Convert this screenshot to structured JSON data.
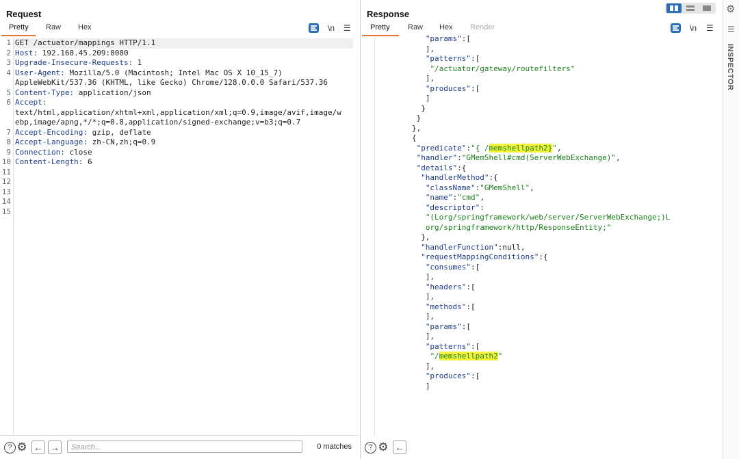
{
  "request": {
    "title": "Request",
    "tabs": [
      "Pretty",
      "Raw",
      "Hex"
    ],
    "newline_label": "\\n",
    "lines": [
      {
        "n": "1",
        "text": "GET /actuator/mappings HTTP/1.1"
      },
      {
        "n": "2",
        "key": "Host:",
        "text": " 192.168.45.209:8080"
      },
      {
        "n": "3",
        "key": "Upgrade-Insecure-Requests:",
        "text": " 1"
      },
      {
        "n": "4",
        "key": "User-Agent:",
        "text": " Mozilla/5.0 (Macintosh; Intel Mac OS X 10_15_7)"
      },
      {
        "n": "",
        "text": "AppleWebKit/537.36 (KHTML, like Gecko) Chrome/128.0.0.0 Safari/537.36"
      },
      {
        "n": "5",
        "key": "Content-Type:",
        "text": " application/json"
      },
      {
        "n": "6",
        "key": "Accept:",
        "text": ""
      },
      {
        "n": "",
        "text": "text/html,application/xhtml+xml,application/xml;q=0.9,image/avif,image/w"
      },
      {
        "n": "",
        "text": "ebp,image/apng,*/*;q=0.8,application/signed-exchange;v=b3;q=0.7"
      },
      {
        "n": "7",
        "key": "Accept-Encoding:",
        "text": " gzip, deflate"
      },
      {
        "n": "8",
        "key": "Accept-Language:",
        "text": " zh-CN,zh;q=0.9"
      },
      {
        "n": "9",
        "key": "Connection:",
        "text": " close"
      },
      {
        "n": "10",
        "key": "Content-Length:",
        "text": " 6"
      },
      {
        "n": "11",
        "text": ""
      },
      {
        "n": "12",
        "text": ""
      },
      {
        "n": "13",
        "text": ""
      },
      {
        "n": "14",
        "text": ""
      },
      {
        "n": "15",
        "text": ""
      }
    ]
  },
  "response": {
    "title": "Response",
    "tabs": [
      "Pretty",
      "Raw",
      "Hex",
      "Render"
    ],
    "newline_label": "\\n",
    "lines": [
      {
        "i": 11,
        "parts": [
          [
            "k",
            "\"params\""
          ],
          [
            "p",
            ":["
          ]
        ]
      },
      {
        "i": 11,
        "parts": [
          [
            "p",
            "],"
          ]
        ]
      },
      {
        "i": 11,
        "parts": [
          [
            "k",
            "\"patterns\""
          ],
          [
            "p",
            ":["
          ]
        ]
      },
      {
        "i": 12,
        "parts": [
          [
            "s",
            "\"/actuator/gateway/routefilters\""
          ]
        ]
      },
      {
        "i": 11,
        "parts": [
          [
            "p",
            "],"
          ]
        ]
      },
      {
        "i": 11,
        "parts": [
          [
            "k",
            "\"produces\""
          ],
          [
            "p",
            ":["
          ]
        ]
      },
      {
        "i": 11,
        "parts": [
          [
            "p",
            "]"
          ]
        ]
      },
      {
        "i": 10,
        "parts": [
          [
            "p",
            "}"
          ]
        ]
      },
      {
        "i": 9,
        "parts": [
          [
            "p",
            "}"
          ]
        ]
      },
      {
        "i": 8,
        "parts": [
          [
            "p",
            "},"
          ]
        ]
      },
      {
        "i": 8,
        "parts": [
          [
            "p",
            "{"
          ]
        ]
      },
      {
        "i": 9,
        "parts": [
          [
            "k",
            "\"predicate\""
          ],
          [
            "p",
            ":"
          ],
          [
            "s",
            "\"{ /"
          ],
          [
            "m",
            "memshellpath2}"
          ],
          [
            "s",
            "\""
          ],
          [
            "p",
            ","
          ]
        ]
      },
      {
        "i": 9,
        "parts": [
          [
            "k",
            "\"handler\""
          ],
          [
            "p",
            ":"
          ],
          [
            "s",
            "\"GMemShell#cmd(ServerWebExchange)\""
          ],
          [
            "p",
            ","
          ]
        ]
      },
      {
        "i": 9,
        "parts": [
          [
            "k",
            "\"details\""
          ],
          [
            "p",
            ":{"
          ]
        ]
      },
      {
        "i": 10,
        "parts": [
          [
            "k",
            "\"handlerMethod\""
          ],
          [
            "p",
            ":{"
          ]
        ]
      },
      {
        "i": 11,
        "parts": [
          [
            "k",
            "\"className\""
          ],
          [
            "p",
            ":"
          ],
          [
            "s",
            "\"GMemShell\""
          ],
          [
            "p",
            ","
          ]
        ]
      },
      {
        "i": 11,
        "parts": [
          [
            "k",
            "\"name\""
          ],
          [
            "p",
            ":"
          ],
          [
            "s",
            "\"cmd\""
          ],
          [
            "p",
            ","
          ]
        ]
      },
      {
        "i": 11,
        "parts": [
          [
            "k",
            "\"descriptor\""
          ],
          [
            "p",
            ":"
          ]
        ]
      },
      {
        "i": 11,
        "parts": [
          [
            "s",
            "\"(Lorg/springframework/web/server/ServerWebExchange;)L"
          ]
        ]
      },
      {
        "i": 11,
        "parts": [
          [
            "s",
            "org/springframework/http/ResponseEntity;\""
          ]
        ]
      },
      {
        "i": 10,
        "parts": [
          [
            "p",
            "},"
          ]
        ]
      },
      {
        "i": 10,
        "parts": [
          [
            "k",
            "\"handlerFunction\""
          ],
          [
            "p",
            ":null,"
          ]
        ]
      },
      {
        "i": 10,
        "parts": [
          [
            "k",
            "\"requestMappingConditions\""
          ],
          [
            "p",
            ":{"
          ]
        ]
      },
      {
        "i": 11,
        "parts": [
          [
            "k",
            "\"consumes\""
          ],
          [
            "p",
            ":["
          ]
        ]
      },
      {
        "i": 11,
        "parts": [
          [
            "p",
            "],"
          ]
        ]
      },
      {
        "i": 11,
        "parts": [
          [
            "k",
            "\"headers\""
          ],
          [
            "p",
            ":["
          ]
        ]
      },
      {
        "i": 11,
        "parts": [
          [
            "p",
            "],"
          ]
        ]
      },
      {
        "i": 11,
        "parts": [
          [
            "k",
            "\"methods\""
          ],
          [
            "p",
            ":["
          ]
        ]
      },
      {
        "i": 11,
        "parts": [
          [
            "p",
            "],"
          ]
        ]
      },
      {
        "i": 11,
        "parts": [
          [
            "k",
            "\"params\""
          ],
          [
            "p",
            ":["
          ]
        ]
      },
      {
        "i": 11,
        "parts": [
          [
            "p",
            "],"
          ]
        ]
      },
      {
        "i": 11,
        "parts": [
          [
            "k",
            "\"patterns\""
          ],
          [
            "p",
            ":["
          ]
        ]
      },
      {
        "i": 12,
        "parts": [
          [
            "s",
            "\"/"
          ],
          [
            "m",
            "memshellpath2"
          ],
          [
            "s",
            "\""
          ]
        ]
      },
      {
        "i": 11,
        "parts": [
          [
            "p",
            "],"
          ]
        ]
      },
      {
        "i": 11,
        "parts": [
          [
            "k",
            "\"produces\""
          ],
          [
            "p",
            ":["
          ]
        ]
      },
      {
        "i": 11,
        "parts": [
          [
            "p",
            "]"
          ]
        ]
      }
    ]
  },
  "search": {
    "placeholder": "Search..."
  },
  "matches_label": "0 matches",
  "inspector": {
    "label": "INSPECTOR"
  },
  "colors": {
    "accent_tab": "#e8702a",
    "button_blue": "#2a6fb5",
    "highlight": "#f3f33e",
    "string": "#1a7f1a",
    "key": "#1d3c88"
  }
}
